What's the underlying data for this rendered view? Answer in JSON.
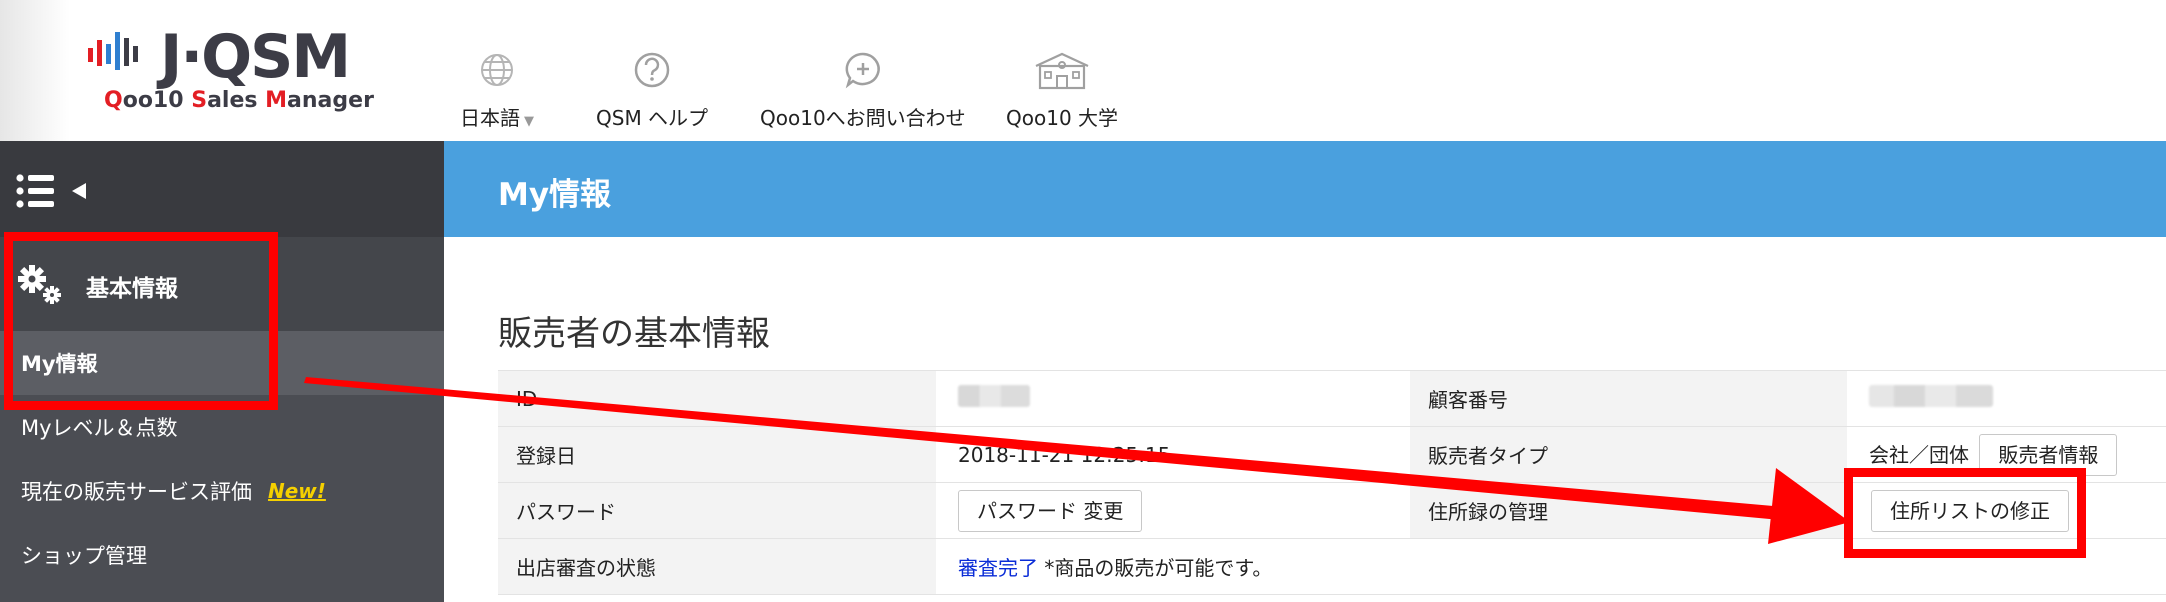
{
  "logo": {
    "word": "J·QSM",
    "sub_q": "Q",
    "sub_rest_1": "oo10 ",
    "sub_s": "S",
    "sub_rest_2": "ales ",
    "sub_m": "M",
    "sub_rest_3": "anager"
  },
  "topnav": [
    {
      "label": "日本語",
      "icon": "globe-icon",
      "caret": "▼"
    },
    {
      "label": "QSM ヘルプ",
      "icon": "question-icon"
    },
    {
      "label": "Qoo10へお問い合わせ",
      "icon": "chat-plus-icon"
    },
    {
      "label": "Qoo10 大学",
      "icon": "school-icon"
    }
  ],
  "sidebar": {
    "toggle_icon": "menu-collapse-icon",
    "section_label": "基本情報",
    "section_icon": "gears-icon",
    "items": [
      {
        "label": "My情報",
        "active": true
      },
      {
        "label": "Myレベル＆点数"
      },
      {
        "label": "現在の販売サービス評価",
        "badge": "New!"
      },
      {
        "label": "ショップ管理"
      }
    ]
  },
  "banner": {
    "title": "My情報"
  },
  "section": {
    "title": "販売者の基本情報"
  },
  "table": {
    "rows": [
      {
        "label1": "ID",
        "value1": "",
        "label2": "顧客番号",
        "value2": ""
      },
      {
        "label1": "登録日",
        "value1": "2018-11-21 12:25:15",
        "label2": "販売者タイプ",
        "value2": "会社／団体",
        "button2": "販売者情報"
      },
      {
        "label1": "パスワード",
        "button1": "パスワード 変更",
        "label2": "住所録の管理",
        "button2": "住所リストの修正"
      },
      {
        "label1": "出店審査の状態",
        "link1": "審査完了",
        "value1": "*商品の販売が可能です。"
      }
    ]
  },
  "colors": {
    "banner": "#4aa0de",
    "sidebar": "#4b4d53",
    "annotation": "#ff0000",
    "badge": "#f5d000",
    "link": "#0a2cd7"
  }
}
